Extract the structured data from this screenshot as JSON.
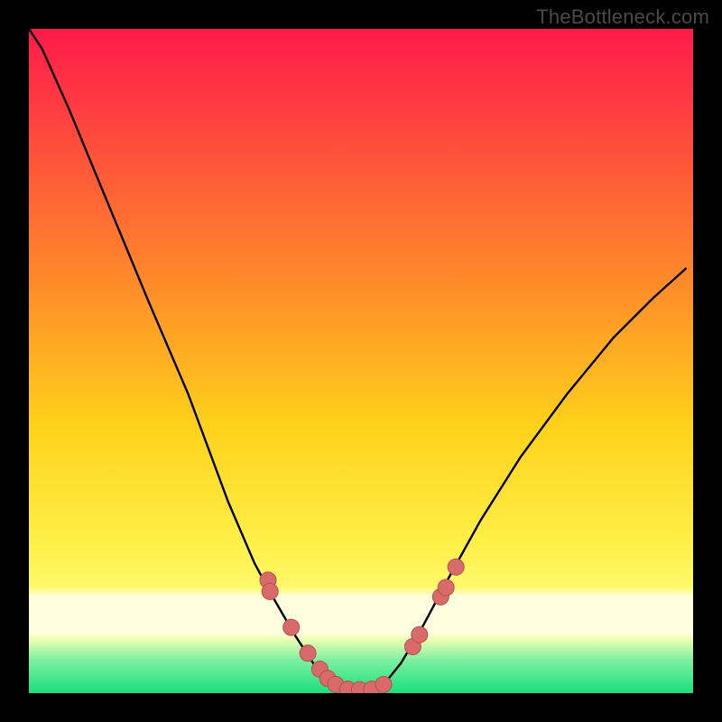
{
  "watermark": {
    "text": "TheBottleneck.com"
  },
  "colors": {
    "bg_top": "#ff1a4b",
    "bg_mid1": "#ff6e2f",
    "bg_mid2": "#ffd21a",
    "bg_lower": "#fff96a",
    "bg_band": "#ffffe0",
    "bg_bottom": "#19e07d",
    "curve": "#000000",
    "dot_fill": "#d96a6a",
    "dot_stroke": "#b94f4f"
  },
  "chart_data": {
    "type": "line",
    "title": "",
    "xlabel": "",
    "ylabel": "",
    "xlim": [
      0,
      1
    ],
    "ylim": [
      0,
      1
    ],
    "series": [
      {
        "name": "bottleneck-curve",
        "x": [
          0.0,
          0.02,
          0.06,
          0.12,
          0.18,
          0.24,
          0.3,
          0.34,
          0.37,
          0.4,
          0.43,
          0.455,
          0.48,
          0.51,
          0.54,
          0.56,
          0.59,
          0.63,
          0.68,
          0.74,
          0.81,
          0.88,
          0.94,
          0.99
        ],
        "values": [
          1.0,
          0.97,
          0.88,
          0.735,
          0.59,
          0.45,
          0.288,
          0.195,
          0.14,
          0.088,
          0.042,
          0.02,
          0.005,
          0.005,
          0.02,
          0.045,
          0.095,
          0.17,
          0.26,
          0.355,
          0.45,
          0.535,
          0.595,
          0.64
        ]
      }
    ],
    "markers": [
      {
        "x": 0.36,
        "y": 0.17
      },
      {
        "x": 0.363,
        "y": 0.153
      },
      {
        "x": 0.395,
        "y": 0.099
      },
      {
        "x": 0.42,
        "y": 0.06
      },
      {
        "x": 0.438,
        "y": 0.036
      },
      {
        "x": 0.45,
        "y": 0.022
      },
      {
        "x": 0.462,
        "y": 0.013
      },
      {
        "x": 0.48,
        "y": 0.006
      },
      {
        "x": 0.498,
        "y": 0.005
      },
      {
        "x": 0.516,
        "y": 0.006
      },
      {
        "x": 0.534,
        "y": 0.013
      },
      {
        "x": 0.578,
        "y": 0.07
      },
      {
        "x": 0.588,
        "y": 0.088
      },
      {
        "x": 0.62,
        "y": 0.145
      },
      {
        "x": 0.628,
        "y": 0.159
      },
      {
        "x": 0.643,
        "y": 0.19
      }
    ]
  }
}
